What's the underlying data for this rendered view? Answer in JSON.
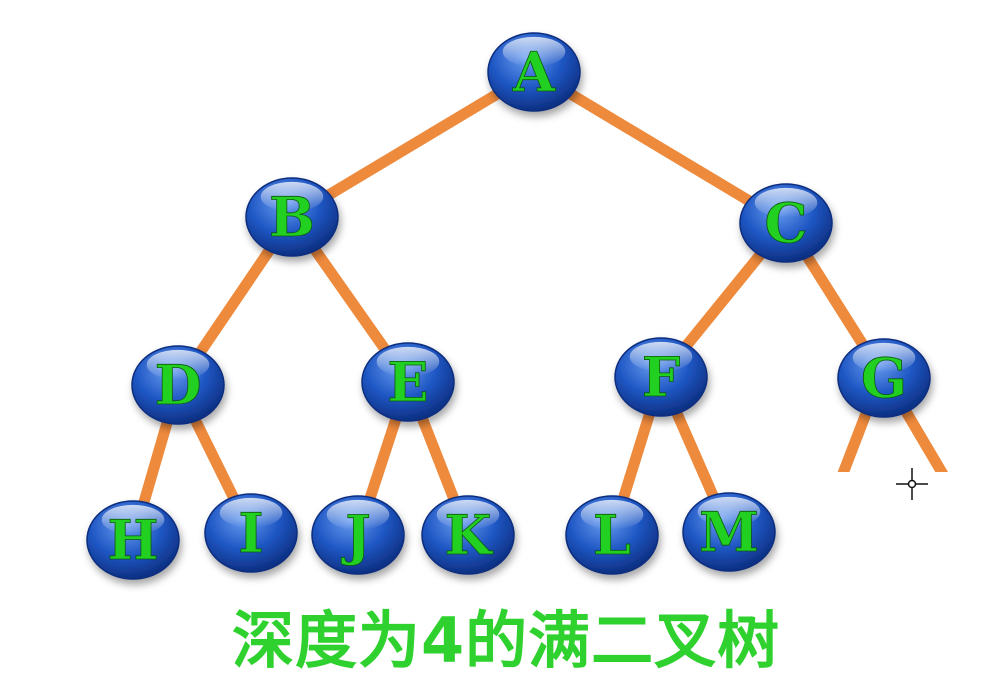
{
  "colors": {
    "edge": "#ee8a3c",
    "label": "#22d022",
    "node_light": "#6a9df0",
    "node_mid": "#1f57c4",
    "node_dark": "#0c2d7e",
    "caption": "#2ed12e"
  },
  "tree": {
    "nodes": [
      {
        "id": "A",
        "label": "A"
      },
      {
        "id": "B",
        "label": "B"
      },
      {
        "id": "C",
        "label": "C"
      },
      {
        "id": "D",
        "label": "D"
      },
      {
        "id": "E",
        "label": "E"
      },
      {
        "id": "F",
        "label": "F"
      },
      {
        "id": "G",
        "label": "G"
      },
      {
        "id": "H",
        "label": "H"
      },
      {
        "id": "I",
        "label": "I"
      },
      {
        "id": "J",
        "label": "J"
      },
      {
        "id": "K",
        "label": "K"
      },
      {
        "id": "L",
        "label": "L"
      },
      {
        "id": "M",
        "label": "M"
      }
    ],
    "edges": [
      {
        "from": "A",
        "to": "B"
      },
      {
        "from": "A",
        "to": "C"
      },
      {
        "from": "B",
        "to": "D"
      },
      {
        "from": "B",
        "to": "E"
      },
      {
        "from": "C",
        "to": "F"
      },
      {
        "from": "C",
        "to": "G"
      },
      {
        "from": "D",
        "to": "H"
      },
      {
        "from": "D",
        "to": "I"
      },
      {
        "from": "E",
        "to": "J"
      },
      {
        "from": "E",
        "to": "K"
      },
      {
        "from": "F",
        "to": "L"
      },
      {
        "from": "F",
        "to": "M"
      }
    ]
  },
  "caption": "深度为4的满二叉树",
  "cursor_icon": "crosshair-cursor-icon"
}
